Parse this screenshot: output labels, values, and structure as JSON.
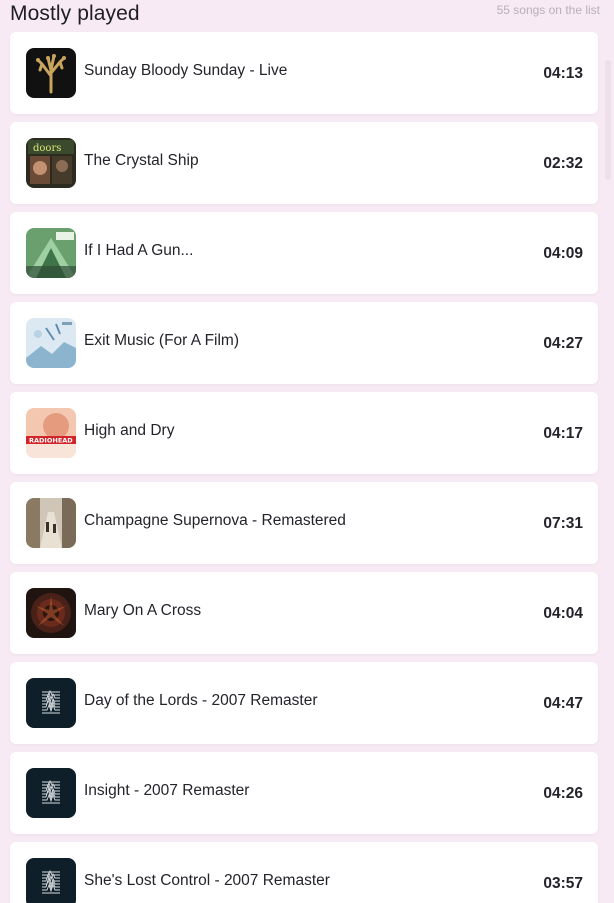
{
  "header": {
    "title": "Mostly played",
    "count_label": "55 songs on the list"
  },
  "songs": [
    {
      "title": "Sunday Bloody Sunday - Live",
      "duration": "04:13",
      "cover_icon": "joshua-tree-cover"
    },
    {
      "title": "The Crystal Ship",
      "duration": "02:32",
      "cover_icon": "the-doors-cover"
    },
    {
      "title": "If I Had A Gun...",
      "duration": "04:09",
      "cover_icon": "high-flying-birds-cover"
    },
    {
      "title": "Exit Music (For A Film)",
      "duration": "04:27",
      "cover_icon": "ok-computer-cover"
    },
    {
      "title": "High and Dry",
      "duration": "04:17",
      "cover_icon": "the-bends-cover"
    },
    {
      "title": "Champagne Supernova - Remastered",
      "duration": "07:31",
      "cover_icon": "morning-glory-cover"
    },
    {
      "title": "Mary On A Cross",
      "duration": "04:04",
      "cover_icon": "seven-inches-of-satanic-panic-cover"
    },
    {
      "title": "Day of the Lords - 2007 Remaster",
      "duration": "04:47",
      "cover_icon": "unknown-pleasures-cover"
    },
    {
      "title": "Insight - 2007 Remaster",
      "duration": "04:26",
      "cover_icon": "unknown-pleasures-cover"
    },
    {
      "title": "She's Lost Control - 2007 Remaster",
      "duration": "03:57",
      "cover_icon": "unknown-pleasures-cover"
    }
  ],
  "colors": {
    "background": "#f7eaf4",
    "card": "#ffffff",
    "text": "#23232b",
    "muted": "#b8b0b8"
  }
}
